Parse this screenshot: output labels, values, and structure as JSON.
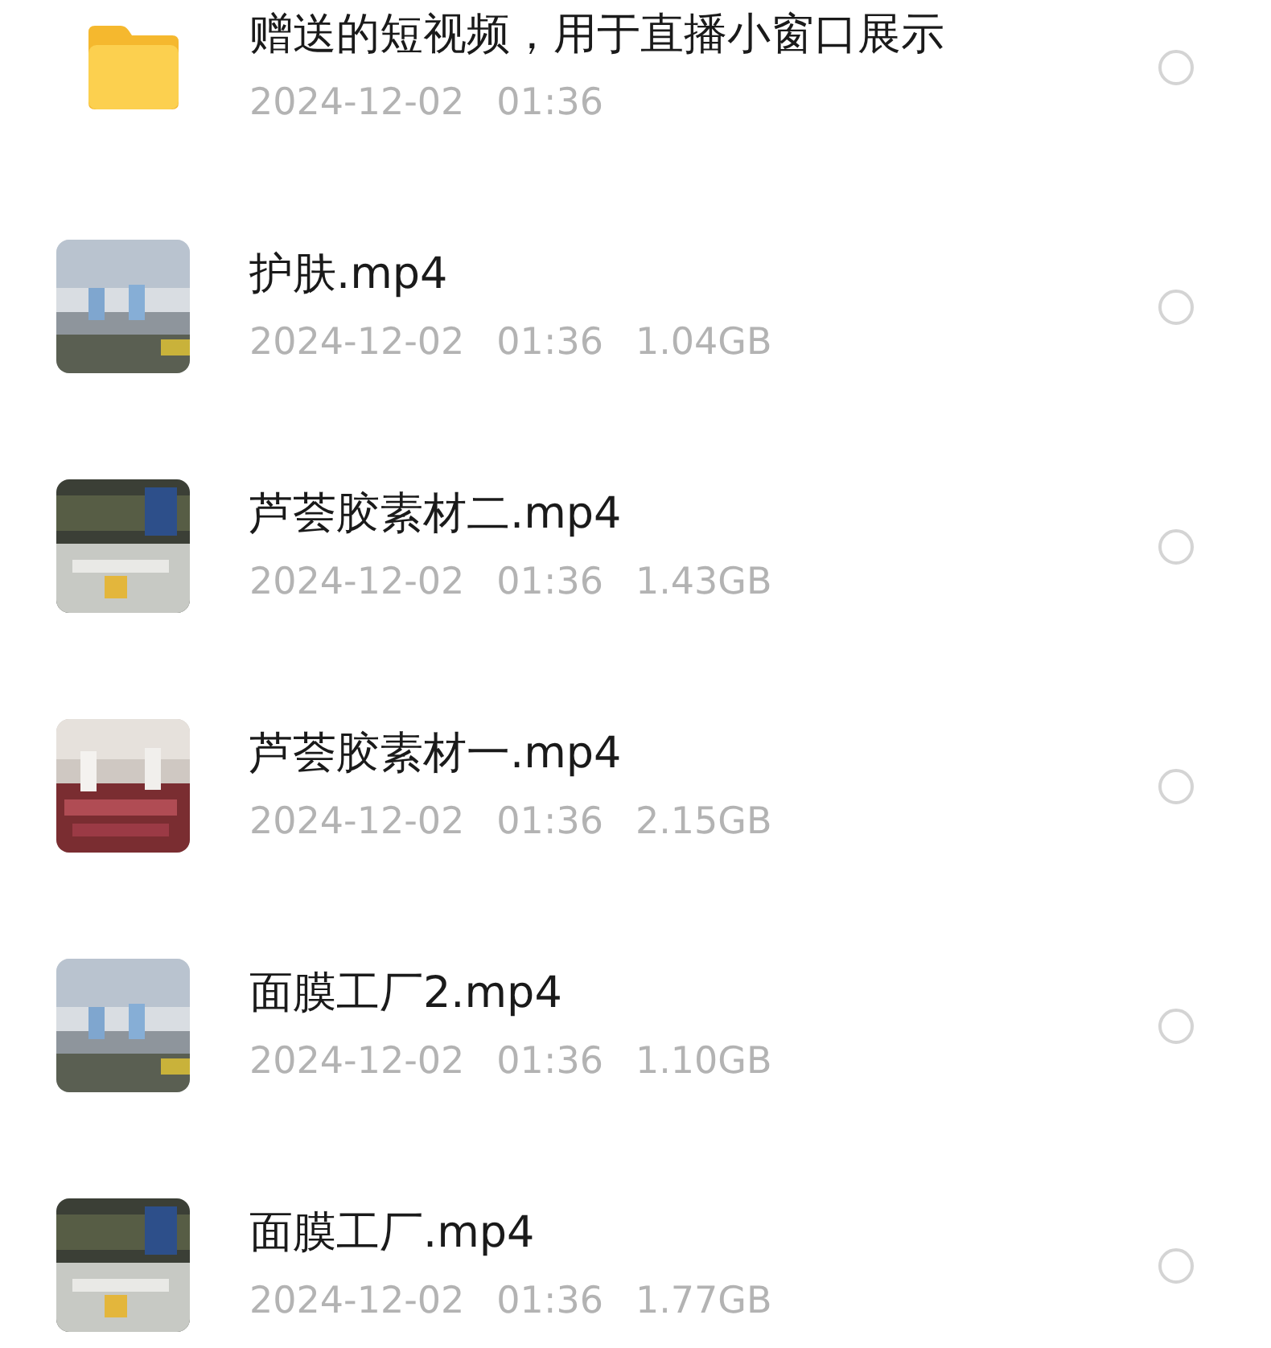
{
  "files": [
    {
      "kind": "folder",
      "name": "赠送的短视频，用于直播小窗口展示",
      "date": "2024-12-02",
      "time": "01:36",
      "selected": false
    },
    {
      "kind": "video",
      "name": "护肤.mp4",
      "date": "2024-12-02",
      "time": "01:36",
      "size": "1.04GB",
      "selected": false
    },
    {
      "kind": "video",
      "name": "芦荟胶素材二.mp4",
      "date": "2024-12-02",
      "time": "01:36",
      "size": "1.43GB",
      "selected": false
    },
    {
      "kind": "video",
      "name": "芦荟胶素材一.mp4",
      "date": "2024-12-02",
      "time": "01:36",
      "size": "2.15GB",
      "selected": false
    },
    {
      "kind": "video",
      "name": "面膜工厂2.mp4",
      "date": "2024-12-02",
      "time": "01:36",
      "size": "1.10GB",
      "selected": false
    },
    {
      "kind": "video",
      "name": "面膜工厂.mp4",
      "date": "2024-12-02",
      "time": "01:36",
      "size": "1.77GB",
      "selected": false
    }
  ]
}
